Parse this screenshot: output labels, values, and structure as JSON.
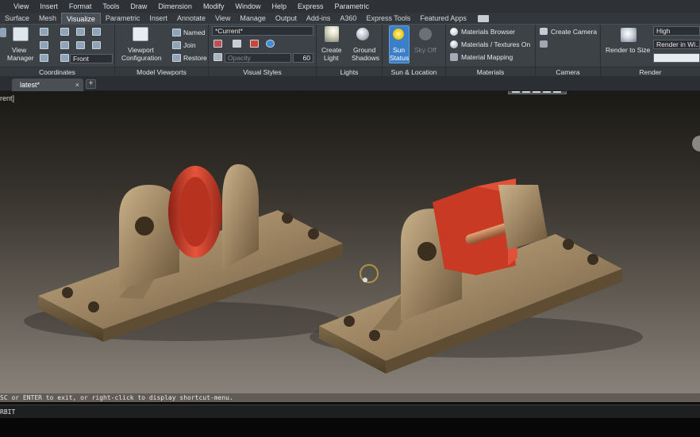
{
  "menubar": {
    "items": [
      "View",
      "Insert",
      "Format",
      "Tools",
      "Draw",
      "Dimension",
      "Modify",
      "Window",
      "Help",
      "Express",
      "Parametric"
    ]
  },
  "tabs": {
    "items": [
      "Surface",
      "Mesh",
      "Visualize",
      "Parametric",
      "Insert",
      "Annotate",
      "View",
      "Manage",
      "Output",
      "Add-ins",
      "A360",
      "Express Tools",
      "Featured Apps"
    ],
    "active": "Visualize"
  },
  "ribbon": {
    "coordinates": {
      "title": "Coordinates",
      "view_manager_line1": "View",
      "view_manager_line2": "Manager",
      "front_value": "Front"
    },
    "model_viewports": {
      "title": "Model Viewports",
      "config_line1": "Viewport",
      "config_line2": "Configuration",
      "named": "Named",
      "join": "Join",
      "restore": "Restore"
    },
    "visual_styles": {
      "title": "Visual Styles",
      "current_value": "*Current*",
      "opacity_placeholder": "Opacity",
      "opacity_value": "60"
    },
    "lights": {
      "title": "Lights",
      "create_line1": "Create",
      "create_line2": "Light",
      "ground_line1": "Ground",
      "ground_line2": "Shadows"
    },
    "sun_location": {
      "title": "Sun & Location",
      "sun_line1": "Sun",
      "sun_line2": "Status",
      "sky_label": "Sky Off"
    },
    "materials": {
      "title": "Materials",
      "browser": "Materials Browser",
      "textures": "Materials / Textures On",
      "mapping": "Material Mapping"
    },
    "camera": {
      "title": "Camera",
      "create_camera": "Create Camera"
    },
    "render": {
      "title": "Render",
      "render_to_size": "Render to Size",
      "quality": "High",
      "render_in": "Render in Wi..."
    }
  },
  "doc": {
    "tab": "latest*",
    "add": "+"
  },
  "viewport": {
    "label": "rent]"
  },
  "command": {
    "hint": "SC or ENTER to exit, or right-click to display shortcut-menu.",
    "line": "RBIT"
  },
  "colors": {
    "bronze": "#9c8462",
    "red": "#d6402b",
    "bg_top": "#1a1915",
    "bg_bottom": "#8a857d"
  }
}
